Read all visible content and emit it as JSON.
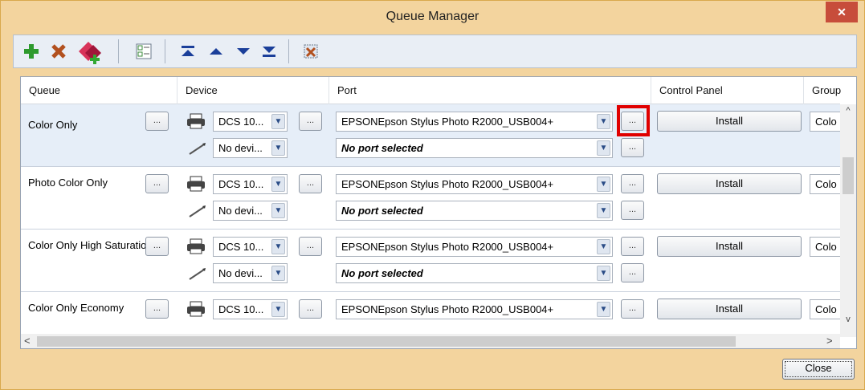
{
  "window": {
    "title": "Queue Manager",
    "close_glyph": "✕"
  },
  "toolbar": {
    "buttons": [
      {
        "name": "add-queue-button",
        "icon": "plus-icon"
      },
      {
        "name": "delete-queue-button",
        "icon": "x-icon"
      },
      {
        "name": "copy-queue-button",
        "icon": "cards-add-icon"
      },
      {
        "name": "properties-button",
        "icon": "checklist-icon"
      },
      {
        "name": "move-top-button",
        "icon": "arrow-top-icon"
      },
      {
        "name": "move-up-button",
        "icon": "arrow-up-icon"
      },
      {
        "name": "move-down-button",
        "icon": "arrow-down-icon"
      },
      {
        "name": "move-bottom-button",
        "icon": "arrow-bottom-icon"
      },
      {
        "name": "remove-image-button",
        "icon": "image-x-icon"
      }
    ]
  },
  "grid": {
    "columns": [
      "Queue",
      "Device",
      "Port",
      "Control Panel",
      "Group"
    ],
    "ellipsis": "...",
    "rows": [
      {
        "queue": "Color Only",
        "device": "DCS 10...",
        "port": "EPSONEpson Stylus Photo R2000_USB004+",
        "control": "Install",
        "group": "Colo",
        "sub_device": "No devi...",
        "sub_port": "No port selected",
        "selected": true
      },
      {
        "queue": "Photo Color Only",
        "device": "DCS 10...",
        "port": "EPSONEpson Stylus Photo R2000_USB004+",
        "control": "Install",
        "group": "Colo",
        "sub_device": "No devi...",
        "sub_port": "No port selected",
        "selected": false
      },
      {
        "queue": "Color Only High Saturatio",
        "device": "DCS 10...",
        "port": "EPSONEpson Stylus Photo R2000_USB004+",
        "control": "Install",
        "group": "Colo",
        "sub_device": "No devi...",
        "sub_port": "No port selected",
        "selected": false
      },
      {
        "queue": "Color Only Economy",
        "device": "DCS 10...",
        "port": "EPSONEpson Stylus Photo R2000_USB004+",
        "control": "Install",
        "group": "Colo",
        "selected": false
      }
    ]
  },
  "scroll": {
    "up": "^",
    "down": "v",
    "left": "<",
    "right": ">"
  },
  "footer": {
    "close_label": "Close"
  }
}
